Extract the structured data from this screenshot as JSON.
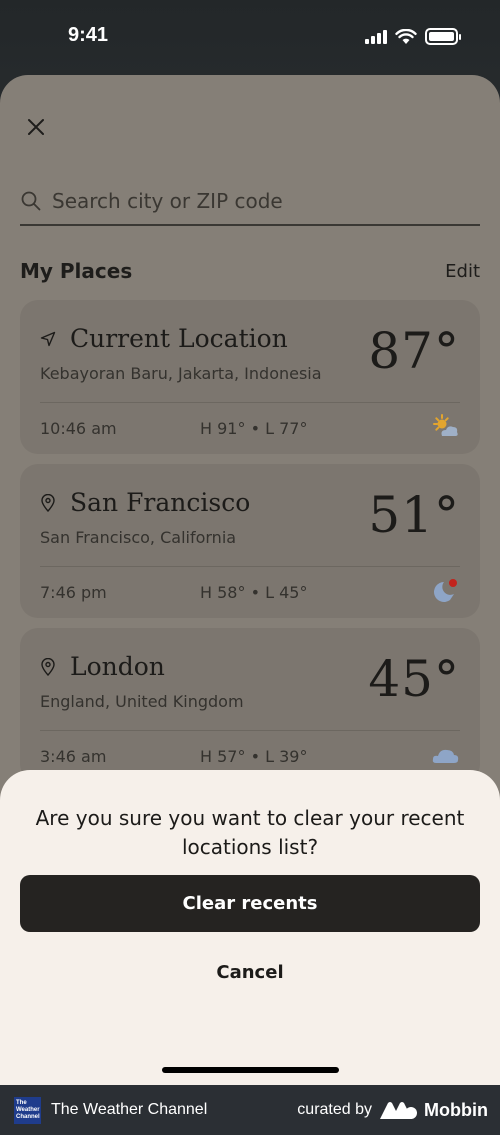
{
  "status_bar": {
    "time": "9:41"
  },
  "search": {
    "placeholder": "Search city or ZIP code"
  },
  "places": {
    "title": "My Places",
    "edit_label": "Edit",
    "items": [
      {
        "name": "Current Location",
        "subtitle": "Kebayoran Baru, Jakarta, Indonesia",
        "temp": "87°",
        "local_time": "10:46 am",
        "high_low": "H 91° • L 77°",
        "icon": "partly-sunny-icon",
        "location_icon": "navigation-arrow-icon"
      },
      {
        "name": "San Francisco",
        "subtitle": "San Francisco, California",
        "temp": "51°",
        "local_time": "7:46 pm",
        "high_low": "H 58° • L 45°",
        "icon": "night-moon-alert-icon",
        "location_icon": "map-pin-icon"
      },
      {
        "name": "London",
        "subtitle": "England, United Kingdom",
        "temp": "45°",
        "local_time": "3:46 am",
        "high_low": "H 57° • L 39°",
        "icon": "cloudy-icon",
        "location_icon": "map-pin-icon"
      }
    ]
  },
  "dialog": {
    "message": "Are you sure you want to clear your recent locations list?",
    "primary_label": "Clear recents",
    "cancel_label": "Cancel"
  },
  "footer": {
    "brand": "The Weather Channel",
    "logo_text": "The Weather Channel",
    "curated_label": "curated by",
    "mobbin_label": "Mobbin"
  },
  "colors": {
    "sheet": "#857f77",
    "card": "#7c766f",
    "dialog": "#f6f0ea",
    "primary_button": "#252321",
    "sun": "#e3a52e",
    "alert_dot": "#c2231c"
  }
}
